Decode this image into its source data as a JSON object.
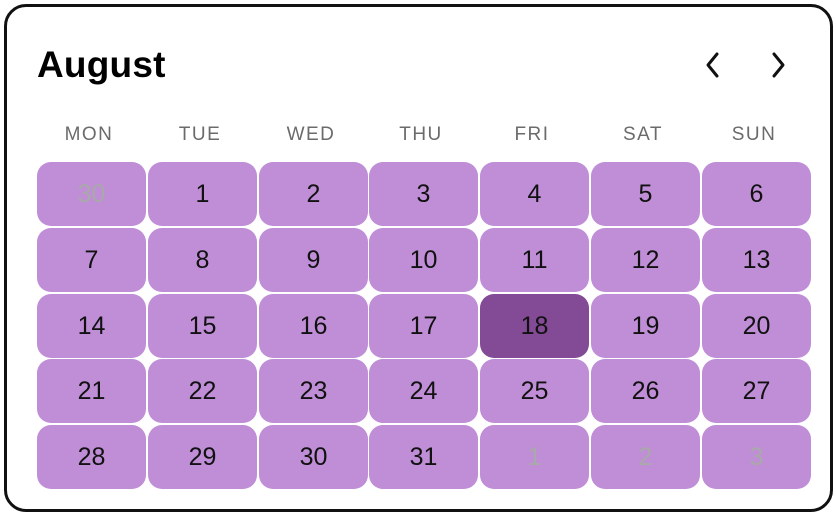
{
  "calendar": {
    "month": "August",
    "weekdays": [
      "MON",
      "TUE",
      "WED",
      "THU",
      "FRI",
      "SAT",
      "SUN"
    ],
    "days": [
      {
        "label": "30",
        "muted": true
      },
      {
        "label": "1"
      },
      {
        "label": "2"
      },
      {
        "label": "3"
      },
      {
        "label": "4"
      },
      {
        "label": "5"
      },
      {
        "label": "6"
      },
      {
        "label": "7"
      },
      {
        "label": "8"
      },
      {
        "label": "9"
      },
      {
        "label": "10"
      },
      {
        "label": "11"
      },
      {
        "label": "12"
      },
      {
        "label": "13"
      },
      {
        "label": "14"
      },
      {
        "label": "15"
      },
      {
        "label": "16"
      },
      {
        "label": "17"
      },
      {
        "label": "18",
        "selected": true
      },
      {
        "label": "19"
      },
      {
        "label": "20"
      },
      {
        "label": "21"
      },
      {
        "label": "22"
      },
      {
        "label": "23"
      },
      {
        "label": "24"
      },
      {
        "label": "25"
      },
      {
        "label": "26"
      },
      {
        "label": "27"
      },
      {
        "label": "28"
      },
      {
        "label": "29"
      },
      {
        "label": "30"
      },
      {
        "label": "31"
      },
      {
        "label": "1",
        "muted": true
      },
      {
        "label": "2",
        "muted": true
      },
      {
        "label": "3",
        "muted": true
      }
    ],
    "icons": {
      "prev": "chevron-left-icon",
      "next": "chevron-right-icon"
    },
    "colors": {
      "day_background": "#bf8ed6",
      "selected_background": "#834a96",
      "muted_text": "#a9a9a9",
      "weekday_text": "#6b6b6b"
    }
  }
}
